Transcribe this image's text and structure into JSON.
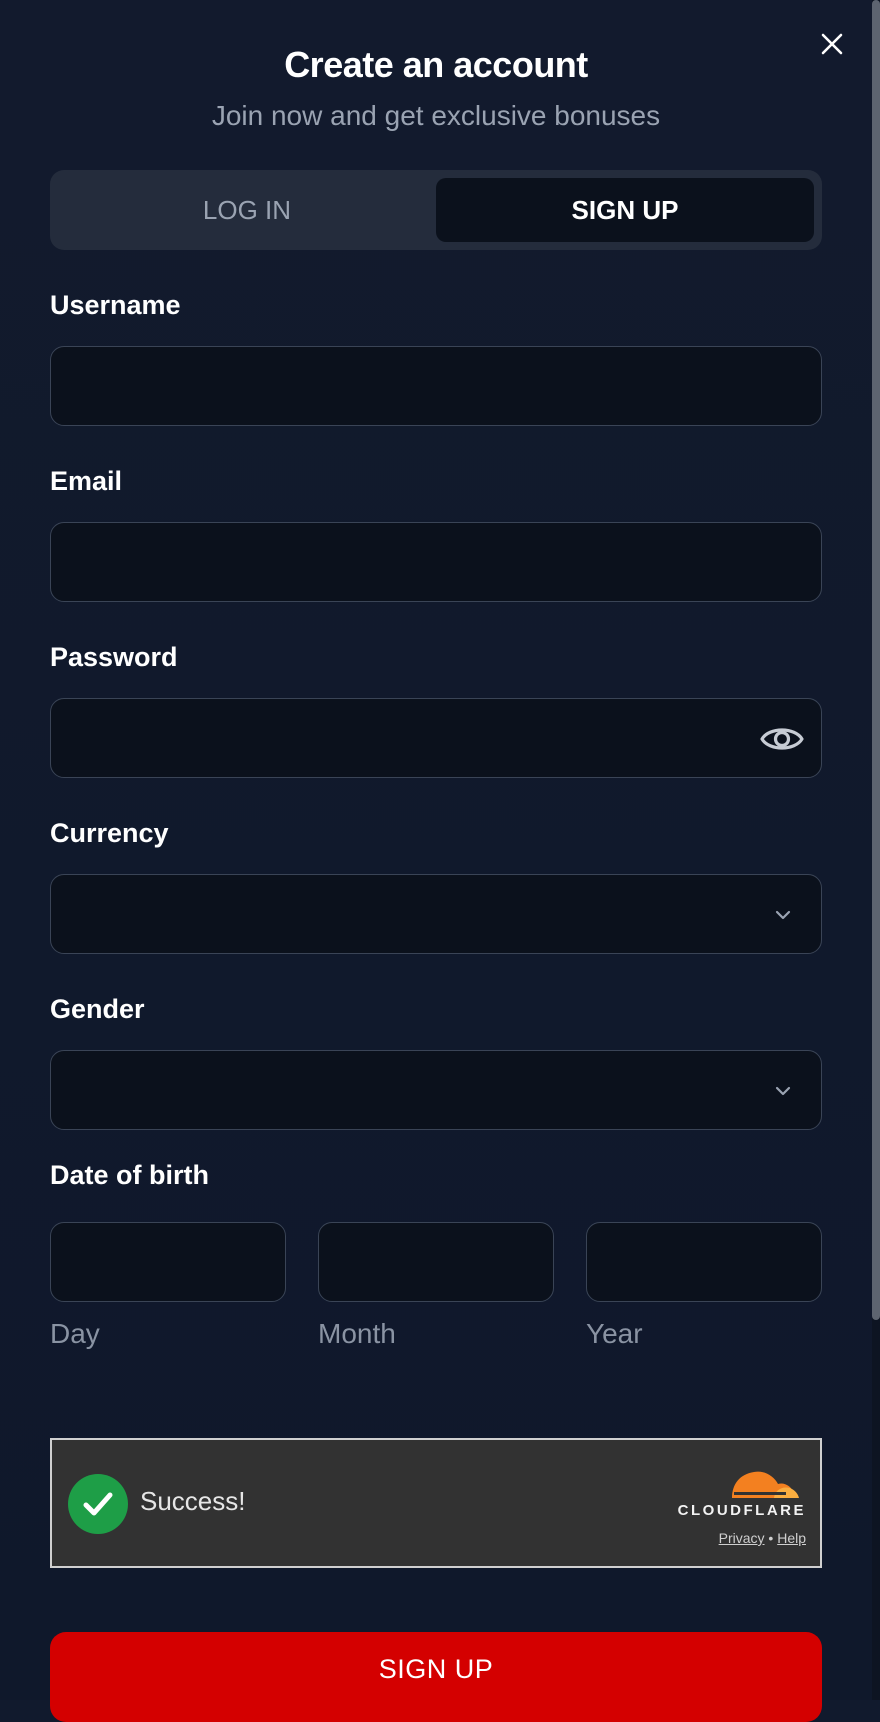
{
  "header": {
    "title": "Create an account",
    "subtitle": "Join now and get exclusive bonuses"
  },
  "tabs": {
    "login": "LOG IN",
    "signup": "SIGN UP",
    "active": "SIGN UP"
  },
  "form": {
    "username_label": "Username",
    "username_value": "",
    "email_label": "Email",
    "email_value": "",
    "password_label": "Password",
    "password_value": "",
    "currency_label": "Currency",
    "currency_value": "",
    "gender_label": "Gender",
    "gender_value": "",
    "dob_label": "Date of birth",
    "dob_day": "Day",
    "dob_month": "Month",
    "dob_year": "Year"
  },
  "captcha": {
    "status": "Success!",
    "brand": "CLOUDFLARE",
    "privacy": "Privacy",
    "separator": "•",
    "help": "Help"
  },
  "submit_label": "SIGN UP",
  "colors": {
    "background": "#111a2d",
    "field_bg": "#0b111c",
    "accent_red": "#d40000",
    "success_green": "#1e9e47",
    "cloudflare_orange": "#f38020"
  },
  "icons": [
    "close-icon",
    "eye-icon",
    "chevron-down-icon",
    "checkmark-icon",
    "cloudflare-logo"
  ]
}
